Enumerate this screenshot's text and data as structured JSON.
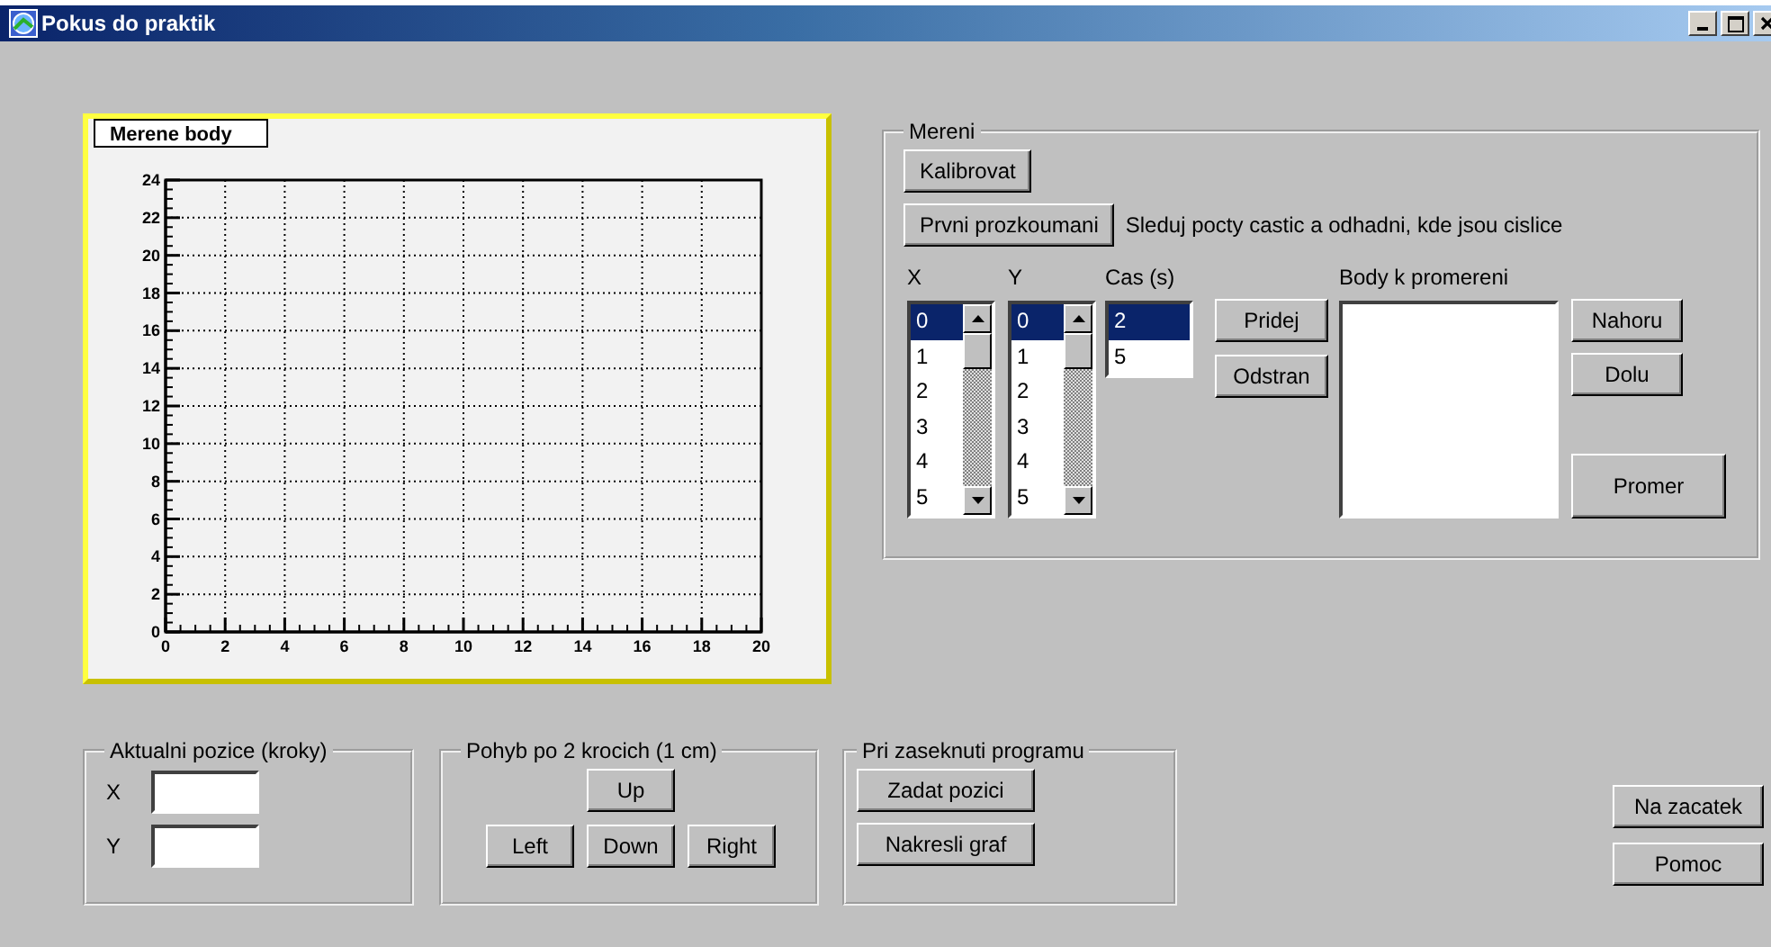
{
  "window": {
    "title": "Pokus do praktik"
  },
  "graph": {
    "chart_data": {
      "type": "scatter",
      "title": "Merene body",
      "xlim": [
        0,
        20
      ],
      "ylim": [
        0,
        24
      ],
      "xticks": [
        0,
        2,
        4,
        6,
        8,
        10,
        12,
        14,
        16,
        18,
        20
      ],
      "yticks": [
        0,
        2,
        4,
        6,
        8,
        10,
        12,
        14,
        16,
        18,
        20,
        22,
        24
      ],
      "grid": true
    }
  },
  "measure": {
    "title": "Mereni",
    "calibrate_button": "Kalibrovat",
    "explore_button": "Prvni prozkoumani",
    "hint": "Sleduj pocty castic a odhadni, kde jsou cislice",
    "x_list": {
      "label": "X",
      "items": [
        {
          "text": "0",
          "selected": true
        },
        {
          "text": "1",
          "selected": false
        },
        {
          "text": "2",
          "selected": false
        },
        {
          "text": "3",
          "selected": false
        },
        {
          "text": "4",
          "selected": false
        },
        {
          "text": "5",
          "selected": false
        }
      ]
    },
    "y_list": {
      "label": "Y",
      "items": [
        {
          "text": "0",
          "selected": true
        },
        {
          "text": "1",
          "selected": false
        },
        {
          "text": "2",
          "selected": false
        },
        {
          "text": "3",
          "selected": false
        },
        {
          "text": "4",
          "selected": false
        },
        {
          "text": "5",
          "selected": false
        }
      ]
    },
    "time_list": {
      "label": "Cas (s)",
      "items": [
        {
          "text": "2",
          "selected": true
        },
        {
          "text": "5",
          "selected": false
        }
      ]
    },
    "add_button": "Pridej",
    "remove_button": "Odstran",
    "points_list": {
      "label": "Body k promereni"
    },
    "up_button": "Nahoru",
    "down_button": "Dolu",
    "measure_button": "Promer"
  },
  "position": {
    "title": "Aktualni pozice (kroky)",
    "fields": [
      {
        "label": "X"
      },
      {
        "label": "Y"
      }
    ]
  },
  "move": {
    "title": "Pohyb po 2 krocich (1 cm)",
    "buttons": [
      "Up",
      "Left",
      "Down",
      "Right"
    ]
  },
  "stuck": {
    "title": "Pri zaseknuti programu",
    "buttons": [
      "Zadat pozici",
      "Nakresli graf"
    ]
  },
  "side_buttons": [
    "Na zacatek",
    "Pomoc"
  ]
}
